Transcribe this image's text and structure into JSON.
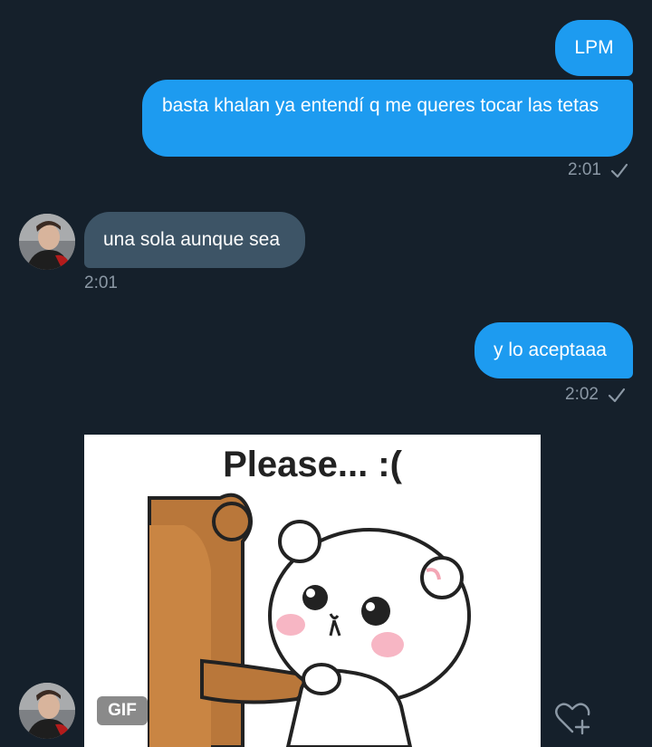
{
  "messages": [
    {
      "side": "out",
      "text": "LPM"
    },
    {
      "side": "out",
      "text": "basta khalan ya entendí q me queres tocar las tetas",
      "time": "2:01"
    },
    {
      "side": "in",
      "text": "una sola aunque sea",
      "time": "2:01"
    },
    {
      "side": "out",
      "text": "y lo aceptaaa",
      "time": "2:02"
    }
  ],
  "gif": {
    "caption": "Please...   :(",
    "badge": "GIF"
  },
  "icons": {
    "read_receipt": "checkmark-icon",
    "like": "heart-plus-icon"
  },
  "colors": {
    "background": "#15202b",
    "outgoing_bubble": "#1d9bf0",
    "incoming_bubble": "#3d5466",
    "timestamp": "#8b98a5"
  }
}
